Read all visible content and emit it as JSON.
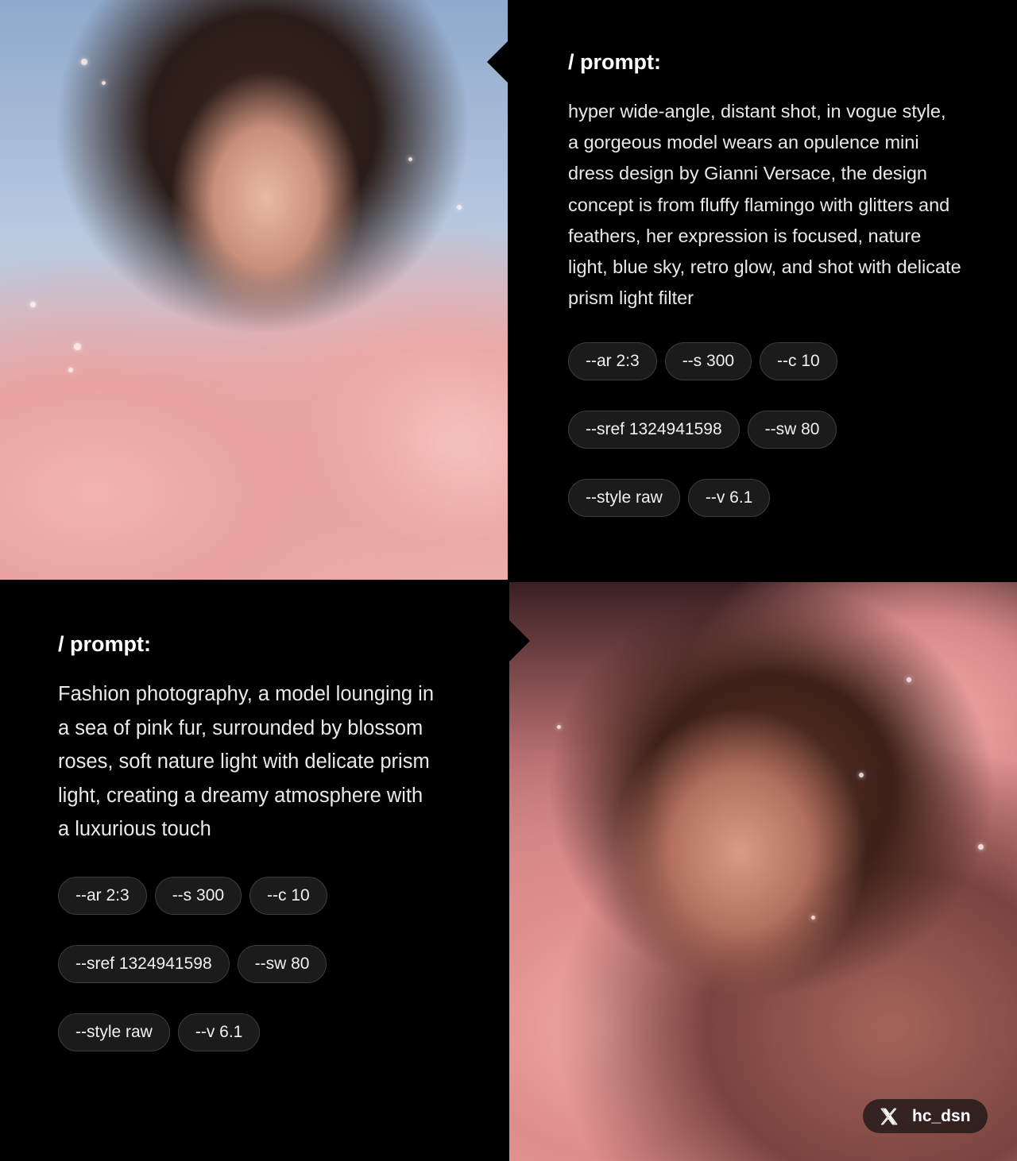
{
  "top_section": {
    "heading": "/ prompt:",
    "prompt": "hyper wide-angle, distant shot, in vogue style, a gorgeous model wears an opulence mini dress design by Gianni Versace, the design concept is from fluffy flamingo with glitters and feathers, her expression is focused, nature light, blue sky, retro glow, and shot with delicate prism light filter",
    "tags": [
      "--ar 2:3",
      "--s 300",
      "--c 10",
      "--sref 1324941598",
      "--sw 80",
      "--style raw",
      "--v 6.1"
    ]
  },
  "bottom_section": {
    "heading": "/ prompt:",
    "prompt": "Fashion photography, a model lounging in a sea of pink fur, surrounded by blossom roses, soft nature light with delicate prism light, creating a dreamy atmosphere with a luxurious touch",
    "tags": [
      "--ar 2:3",
      "--s 300",
      "--c 10",
      "--sref 1324941598",
      "--sw 80",
      "--style raw",
      "--v 6.1"
    ]
  },
  "credit": {
    "icon": "x-logo-icon",
    "handle": "hc_dsn"
  },
  "colors": {
    "background": "#000000",
    "tag_background": "#1b1b1b",
    "tag_border": "#3d3d3d",
    "text": "#e9e9e9"
  }
}
